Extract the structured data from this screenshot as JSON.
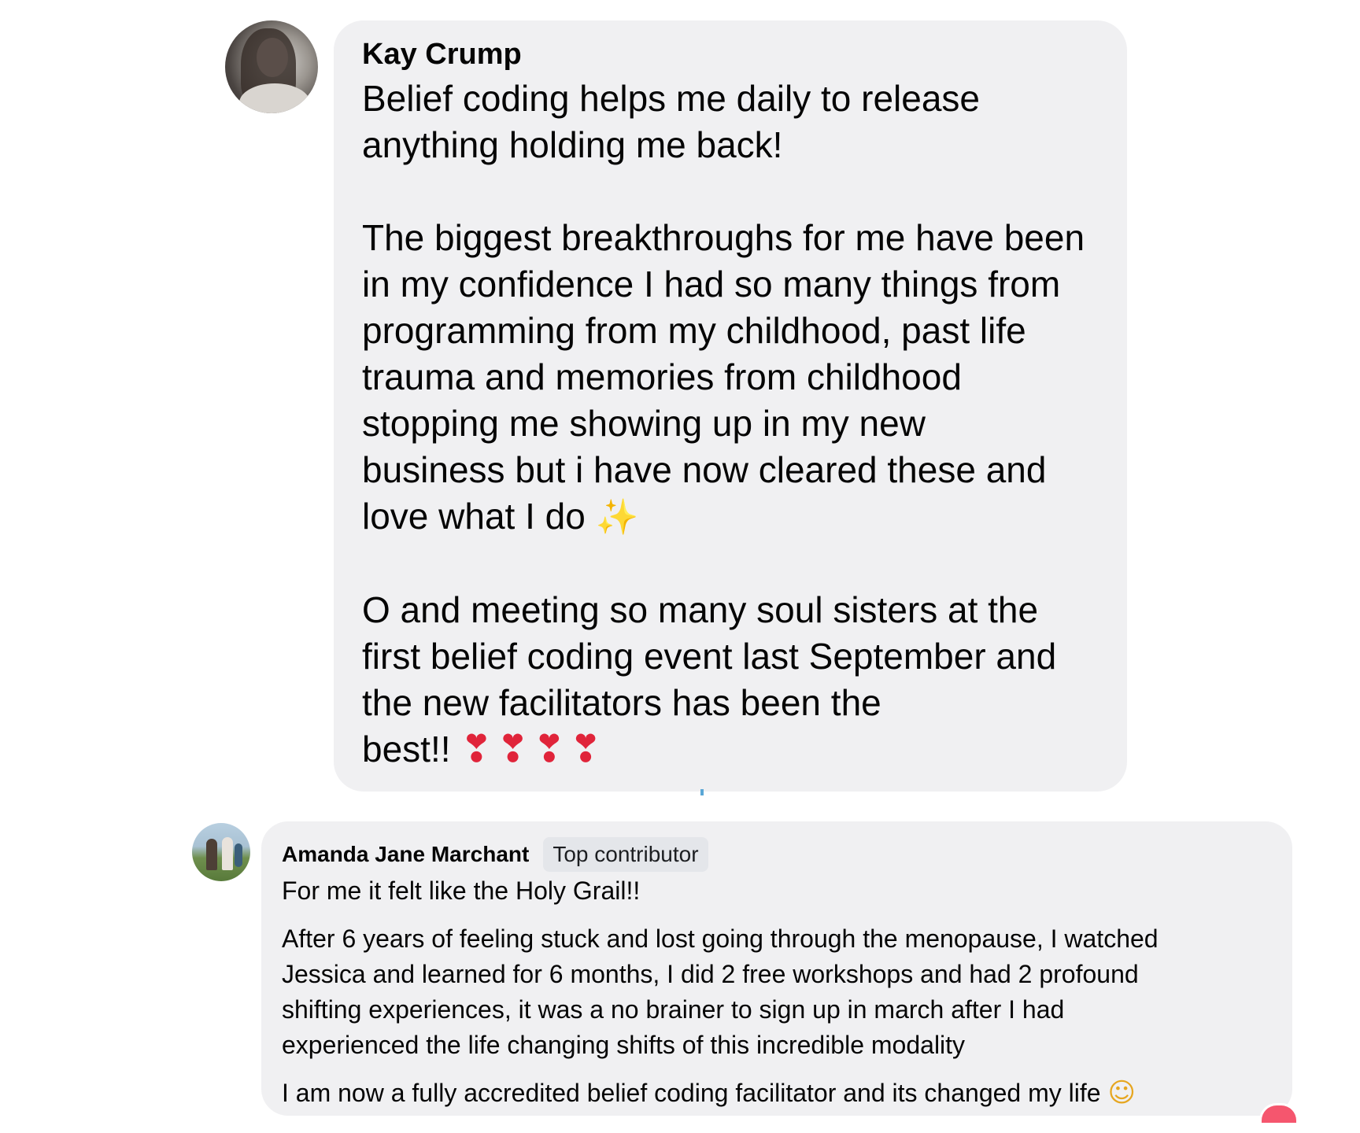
{
  "comments": [
    {
      "author": "Kay Crump",
      "paragraphs": [
        "Belief coding helps me daily to release\nanything holding me back!",
        "The biggest breakthroughs for me have been\nin my confidence I had so many things from\nprogramming from my childhood, past life\ntrauma and memories from childhood\nstopping me showing up in my new\nbusiness but i have now cleared these and\nlove what I do",
        "O and meeting so many soul sisters at the\nfirst belief coding event last September and\nthe new facilitators has been the\nbest!!"
      ],
      "emoji_sparkles": "✨",
      "emoji_hearts": "❣❣❣❣"
    },
    {
      "author": "Amanda Jane Marchant",
      "badge": "Top contributor",
      "paragraphs": [
        "For me it felt like the Holy Grail!!",
        "After 6 years of feeling stuck and lost going through the menopause, I watched\nJessica and learned for 6 months, I did 2 free workshops and had 2 profound\nshifting experiences, it was a no brainer to sign up in march after I had\nexperienced the life changing shifts of this incredible modality",
        "I am now a fully accredited belief coding facilitator and its changed my life"
      ],
      "emoji_grin": "☺"
    }
  ],
  "icons": {
    "kay_avatar": "avatar-photo",
    "amanda_avatar": "avatar-photo",
    "reaction": "heart-reaction-icon"
  },
  "colors": {
    "bubble_bg": "#f0f0f2",
    "badge_bg": "#e4e6ea",
    "text": "#050505"
  }
}
